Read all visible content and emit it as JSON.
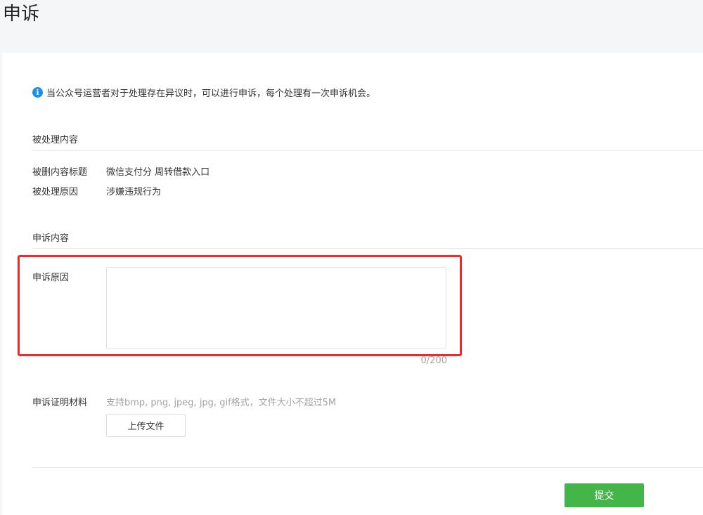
{
  "page": {
    "title": "申诉"
  },
  "notice": {
    "icon": "info-icon",
    "text": "当公众号运营者对于处理存在异议时，可以进行申诉，每个处理有一次申诉机会。"
  },
  "handled_section": {
    "title": "被处理内容",
    "rows": [
      {
        "label": "被删内容标题",
        "value": "微信支付分 周转借款入口"
      },
      {
        "label": "被处理原因",
        "value": "涉嫌违规行为"
      }
    ]
  },
  "appeal_section": {
    "title": "申诉内容",
    "reason": {
      "label": "申诉原因",
      "value": "",
      "placeholder": "",
      "counter": "0/200"
    },
    "evidence": {
      "label": "申诉证明材料",
      "hint": "支持bmp, png, jpeg, jpg, gif格式，文件大小不超过5M",
      "upload_label": "上传文件"
    }
  },
  "actions": {
    "submit_label": "提交"
  },
  "colors": {
    "accent_green": "#44b549",
    "info_blue": "#1e8fe8",
    "highlight_red": "#ee2b2b"
  }
}
